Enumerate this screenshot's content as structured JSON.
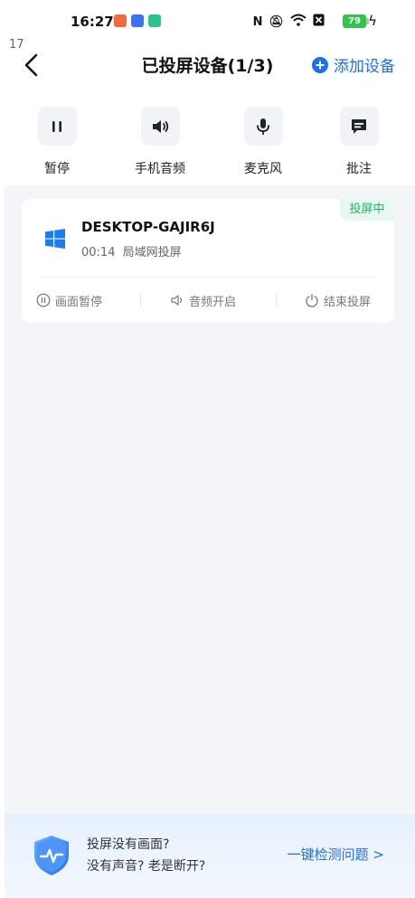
{
  "status_bar": {
    "time": "16:27",
    "battery": "79",
    "overlay_number": "17"
  },
  "header": {
    "title": "已投屏设备(1/3)",
    "add_device": "添加设备"
  },
  "controls": [
    {
      "label": "暂停",
      "icon": "pause-icon"
    },
    {
      "label": "手机音频",
      "icon": "speaker-icon"
    },
    {
      "label": "麦克风",
      "icon": "microphone-icon"
    },
    {
      "label": "批注",
      "icon": "annotation-icon"
    }
  ],
  "device": {
    "badge": "投屏中",
    "name": "DESKTOP-GAJIR6J",
    "duration": "00:14",
    "mode": "局域网投屏",
    "actions": [
      {
        "label": "画面暂停",
        "icon": "pause-circle-icon"
      },
      {
        "label": "音频开启",
        "icon": "speaker-outline-icon"
      },
      {
        "label": "结束投屏",
        "icon": "power-icon"
      }
    ]
  },
  "banner": {
    "line1": "投屏没有画面?",
    "line2": "没有声音? 老是断开?",
    "link": "一键检测问题 >"
  },
  "colors": {
    "accent": "#1e6ff0",
    "status_green": "#21b36b",
    "background": "#f3f5f9"
  }
}
